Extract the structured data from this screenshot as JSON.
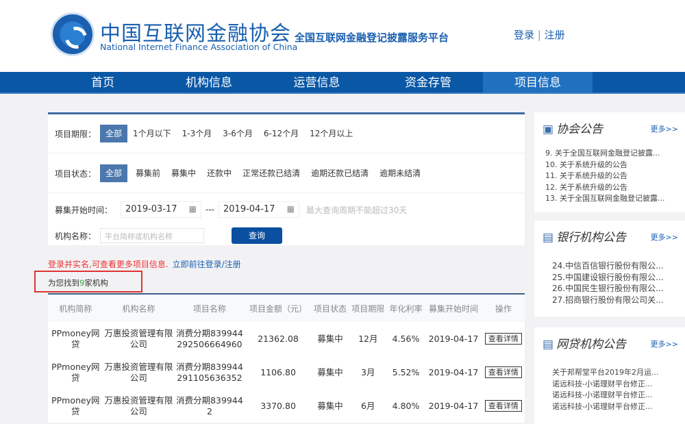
{
  "header": {
    "org_cn": "中国互联网金融协会",
    "org_en": "National Internet Finance Association of China",
    "platform": "全国互联网金融登记披露服务平台",
    "login": "登录",
    "sep": "|",
    "register": "注册"
  },
  "nav": [
    "首页",
    "机构信息",
    "运营信息",
    "资金存管",
    "项目信息"
  ],
  "filters": {
    "period_label": "项目期限：",
    "period_options": [
      "全部",
      "1个月以下",
      "1-3个月",
      "3-6个月",
      "6-12个月",
      "12个月以上"
    ],
    "status_label": "项目状态：",
    "status_options": [
      "全部",
      "募集前",
      "募集中",
      "还款中",
      "正常还款已结清",
      "逾期还款已结清",
      "逾期未结清"
    ],
    "date_label": "募集开始时间：",
    "date_from": "2019-03-17",
    "date_to": "2019-04-17",
    "date_sep": "---",
    "date_hint": "最大查询周期不能超过30天",
    "name_label": "机构名称：",
    "name_placeholder": "平台简称或机构名称",
    "query": "查询"
  },
  "notice": {
    "text": "登录并实名,可查看更多项目信息.",
    "link": "立即前往登录/注册"
  },
  "found": {
    "pre": "为您找到",
    "count": "9",
    "post": "家机构"
  },
  "table": {
    "headers": [
      "机构简称",
      "机构名称",
      "项目名称",
      "项目金额（元）",
      "项目状态",
      "项目期限",
      "年化利率",
      "募集开始时间",
      "操作"
    ],
    "rows": [
      [
        "PPmoney网贷",
        "万惠投资管理有限公司",
        "消费分期839944292506664960",
        "21362.08",
        "募集中",
        "12月",
        "4.56%",
        "2019-04-17",
        "查看详情"
      ],
      [
        "PPmoney网贷",
        "万惠投资管理有限公司",
        "消费分期839944291105636352",
        "1106.80",
        "募集中",
        "3月",
        "5.52%",
        "2019-04-17",
        "查看详情"
      ],
      [
        "PPmoney网贷",
        "万惠投资管理有限公司",
        "消费分期8399442",
        "3370.80",
        "募集中",
        "6月",
        "4.80%",
        "2019-04-17",
        "查看详情"
      ]
    ]
  },
  "side": [
    {
      "title": "协会公告",
      "more": "更多>>",
      "items": [
        "9. 关于全国互联网金融登记披露...",
        "10. 关于系统升级的公告",
        "11. 关于系统升级的公告",
        "12. 关于系统升级的公告",
        "13. 关于全国互联网金融登记披露..."
      ]
    },
    {
      "title": "银行机构公告",
      "more": "更多>>",
      "items": [
        "24.中信百信银行股份有限公...",
        "25.中国建设银行股份有限公...",
        "26.中国民生银行股份有限公...",
        "27.招商银行股份有限公司关..."
      ]
    },
    {
      "title": "网贷机构公告",
      "more": "更多>>",
      "items": [
        "关于邦帮堂平台2019年2月运...",
        "诺远科技-小诺理财平台修正...",
        "诺远科技-小诺理财平台修正...",
        "诺远科技-小诺理财平台修正..."
      ]
    }
  ]
}
